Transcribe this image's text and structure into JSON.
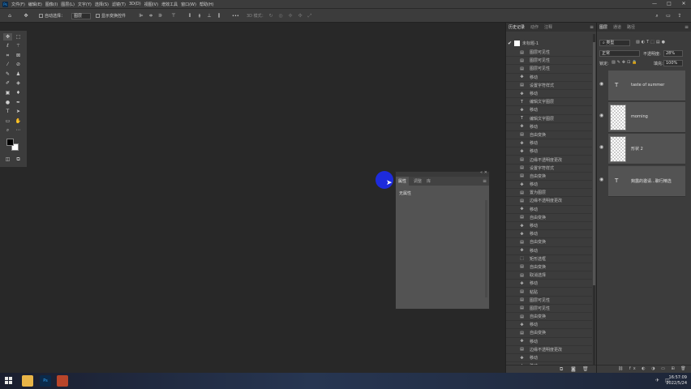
{
  "menubar": {
    "logo": "Ps",
    "items": [
      "文件(F)",
      "编辑(E)",
      "图像(I)",
      "图层(L)",
      "文字(Y)",
      "选择(S)",
      "滤镜(T)",
      "3D(D)",
      "视图(V)",
      "增效工具",
      "窗口(W)",
      "帮助(H)"
    ],
    "window_controls": [
      "—",
      "□",
      "✕"
    ]
  },
  "options_bar": {
    "auto_select_label": "自动选择：",
    "auto_select_value": "图层",
    "show_transform_label": "显示变换控件",
    "more_label": "•••",
    "mode_3d_label": "3D 模式："
  },
  "properties_panel": {
    "tabs": [
      "属性",
      "调整",
      "库"
    ],
    "no_properties": "无属性"
  },
  "history_panel": {
    "tabs": [
      "历史记录",
      "动作",
      "注释"
    ],
    "snapshot": "未标题-1",
    "items": [
      {
        "icon": "layer-icon",
        "label": "图层可见性"
      },
      {
        "icon": "layer-icon",
        "label": "图层可见性"
      },
      {
        "icon": "layer-icon",
        "label": "图层可见性"
      },
      {
        "icon": "move-icon",
        "label": "移动"
      },
      {
        "icon": "layer-icon",
        "label": "设置字符样式"
      },
      {
        "icon": "move-icon",
        "label": "移动"
      },
      {
        "icon": "type-icon",
        "label": "编辑文字图层"
      },
      {
        "icon": "move-icon",
        "label": "移动"
      },
      {
        "icon": "type-icon",
        "label": "编辑文字图层"
      },
      {
        "icon": "move-icon",
        "label": "移动"
      },
      {
        "icon": "layer-icon",
        "label": "自由变换"
      },
      {
        "icon": "move-icon",
        "label": "移动"
      },
      {
        "icon": "move-icon",
        "label": "移动"
      },
      {
        "icon": "layer-icon",
        "label": "边缘不透明度更改"
      },
      {
        "icon": "layer-icon",
        "label": "设置字符样式"
      },
      {
        "icon": "layer-icon",
        "label": "自由变换"
      },
      {
        "icon": "move-icon",
        "label": "移动"
      },
      {
        "icon": "layer-icon",
        "label": "置为图层"
      },
      {
        "icon": "layer-icon",
        "label": "边缘不透明度更改"
      },
      {
        "icon": "move-icon",
        "label": "移动"
      },
      {
        "icon": "layer-icon",
        "label": "自由变换"
      },
      {
        "icon": "move-icon",
        "label": "移动"
      },
      {
        "icon": "move-icon",
        "label": "移动"
      },
      {
        "icon": "layer-icon",
        "label": "自由变换"
      },
      {
        "icon": "move-icon",
        "label": "移动"
      },
      {
        "icon": "select-icon",
        "label": "矩形选框"
      },
      {
        "icon": "layer-icon",
        "label": "自由变换"
      },
      {
        "icon": "layer-icon",
        "label": "取消选择"
      },
      {
        "icon": "move-icon",
        "label": "移动"
      },
      {
        "icon": "layer-icon",
        "label": "粘贴"
      },
      {
        "icon": "layer-icon",
        "label": "图层可见性"
      },
      {
        "icon": "layer-icon",
        "label": "图层可见性"
      },
      {
        "icon": "layer-icon",
        "label": "自由变换"
      },
      {
        "icon": "move-icon",
        "label": "移动"
      },
      {
        "icon": "layer-icon",
        "label": "自由变换"
      },
      {
        "icon": "move-icon",
        "label": "移动"
      },
      {
        "icon": "layer-icon",
        "label": "边缘不透明度更改"
      },
      {
        "icon": "move-icon",
        "label": "移动"
      },
      {
        "icon": "move-icon",
        "label": "移动"
      }
    ]
  },
  "layers_panel": {
    "tabs": [
      "图层",
      "通道",
      "路径"
    ],
    "filter": "类型",
    "blend_mode": "正常",
    "opacity_label": "不透明度:",
    "opacity_value": "28%",
    "lock_label": "锁定:",
    "fill_label": "填充:",
    "fill_value": "100%",
    "layers": [
      {
        "kind": "text",
        "name": "taste of summer"
      },
      {
        "kind": "pixel",
        "name": "morning"
      },
      {
        "kind": "pixel",
        "name": "形状 2"
      },
      {
        "kind": "text",
        "name": "夠露的邀请...聊行精选"
      }
    ]
  },
  "taskbar": {
    "time": "16:57:09",
    "date": "2022/5/24",
    "app_ps": "Ps"
  }
}
